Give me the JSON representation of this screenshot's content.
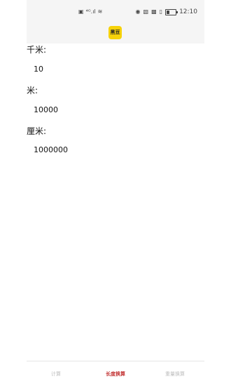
{
  "status_bar": {
    "left_icons": [
      "sim-icon",
      "signal-icon",
      "wifi-icon"
    ],
    "right_icons": [
      "eye-icon",
      "nfc-icon",
      "mute-icon",
      "vibrate-icon",
      "battery-icon"
    ],
    "time": "12:10"
  },
  "app_icon": {
    "label": "黑豆"
  },
  "conversions": [
    {
      "unit_label": "千米:",
      "value": "10"
    },
    {
      "unit_label": "米:",
      "value": "10000"
    },
    {
      "unit_label": "厘米:",
      "value": "1000000"
    }
  ],
  "bottom_nav": {
    "tabs": [
      {
        "label": "计算"
      },
      {
        "label": "长度换算"
      },
      {
        "label": "重量换算"
      }
    ],
    "active_color": "#c33434",
    "inactive_color": "#bdbdbd"
  }
}
